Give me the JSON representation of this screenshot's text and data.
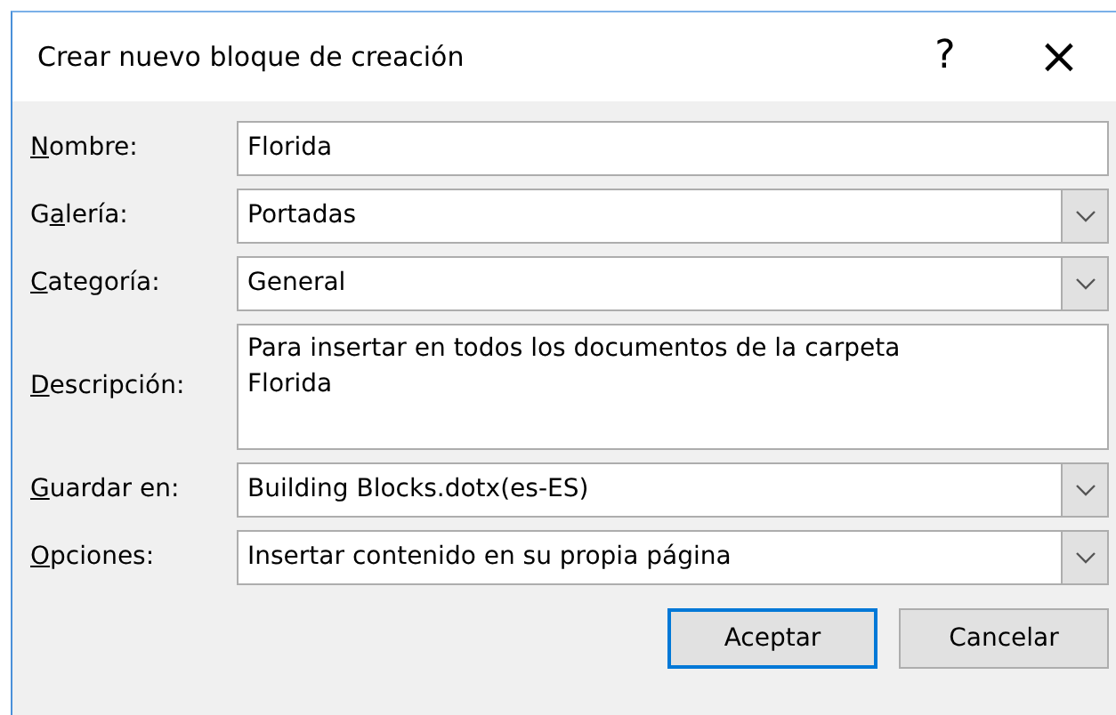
{
  "window": {
    "title": "Crear nuevo bloque de creación",
    "help": "?",
    "close": "×"
  },
  "fields": [
    {
      "kind": "text",
      "label": {
        "key": "N",
        "after": "ombre:"
      },
      "value": "Florida"
    },
    {
      "kind": "dropdown",
      "label": {
        "before": "G",
        "key": "a",
        "after": "lería:"
      },
      "value": "Portadas"
    },
    {
      "kind": "dropdown",
      "label": {
        "key": "C",
        "after": "ategoría:"
      },
      "value": "General"
    },
    {
      "kind": "multiline",
      "label": {
        "key": "D",
        "after": "escripción:"
      },
      "value": "Para insertar en todos los documentos de la carpeta Florida"
    },
    {
      "kind": "dropdown",
      "label": {
        "key": "G",
        "after": "uardar en:"
      },
      "value": "Building Blocks.dotx(es-ES)"
    },
    {
      "kind": "dropdown",
      "label": {
        "key": "O",
        "after": "pciones:"
      },
      "value": "Insertar contenido en su propia página"
    }
  ],
  "buttons": [
    {
      "label": "Aceptar",
      "default": true
    },
    {
      "label": "Cancelar",
      "default": false
    }
  ]
}
